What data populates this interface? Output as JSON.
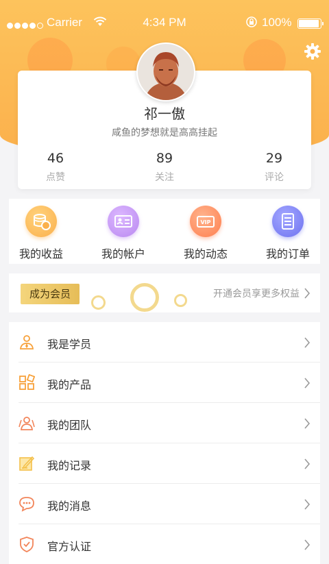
{
  "status_bar": {
    "carrier": "Carrier",
    "time": "4:34 PM",
    "battery": "100%",
    "battery_level": 1.0
  },
  "profile": {
    "name": "祁一傲",
    "bio": "咸鱼的梦想就是高高挂起",
    "stats": [
      {
        "value": "46",
        "label": "点赞"
      },
      {
        "value": "89",
        "label": "关注"
      },
      {
        "value": "29",
        "label": "评论"
      }
    ]
  },
  "quick_actions": [
    {
      "label": "我的收益",
      "icon": "coins-icon",
      "color": "#fbb04c"
    },
    {
      "label": "我的帐户",
      "icon": "id-card-icon",
      "color": "#c79cf3"
    },
    {
      "label": "我的动态",
      "icon": "vip-icon",
      "color": "#ff8a5c"
    },
    {
      "label": "我的订单",
      "icon": "order-list-icon",
      "color": "#7b7ff5"
    }
  ],
  "membership": {
    "badge": "成为会员",
    "promo": "开通会员享更多权益"
  },
  "menu": [
    {
      "label": "我是学员",
      "icon": "student-icon"
    },
    {
      "label": "我的产品",
      "icon": "products-icon"
    },
    {
      "label": "我的团队",
      "icon": "team-icon"
    },
    {
      "label": "我的记录",
      "icon": "record-icon"
    },
    {
      "label": "我的消息",
      "icon": "message-icon"
    },
    {
      "label": "官方认证",
      "icon": "certified-icon"
    }
  ],
  "colors": {
    "accent": "#fbb04c",
    "icon_orange": "#f7a13a"
  }
}
